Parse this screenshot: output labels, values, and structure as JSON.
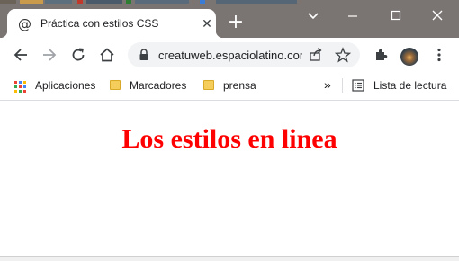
{
  "window": {
    "tab_title": "Práctica con estilos CSS",
    "new_tab_label": "+",
    "controls": {
      "minimize": "–",
      "maximize": "□",
      "close": "✕"
    }
  },
  "toolbar": {
    "url": "creatuweb.espaciolatino.com/...",
    "icons": [
      "back-icon",
      "forward-icon",
      "reload-icon",
      "home-icon",
      "lock-icon",
      "share-icon",
      "star-icon",
      "extensions-icon",
      "avatar",
      "menu-icon"
    ]
  },
  "bookmarks": {
    "apps": "Aplicaciones",
    "items": [
      "Marcadores",
      "prensa"
    ],
    "overflow": "»",
    "reading_list": "Lista de lectura"
  },
  "page": {
    "heading": "Los estilos en linea"
  },
  "colors": {
    "titlebar": "#7a7472",
    "heading": "#ff0000",
    "folder": "#f4cd5b"
  }
}
